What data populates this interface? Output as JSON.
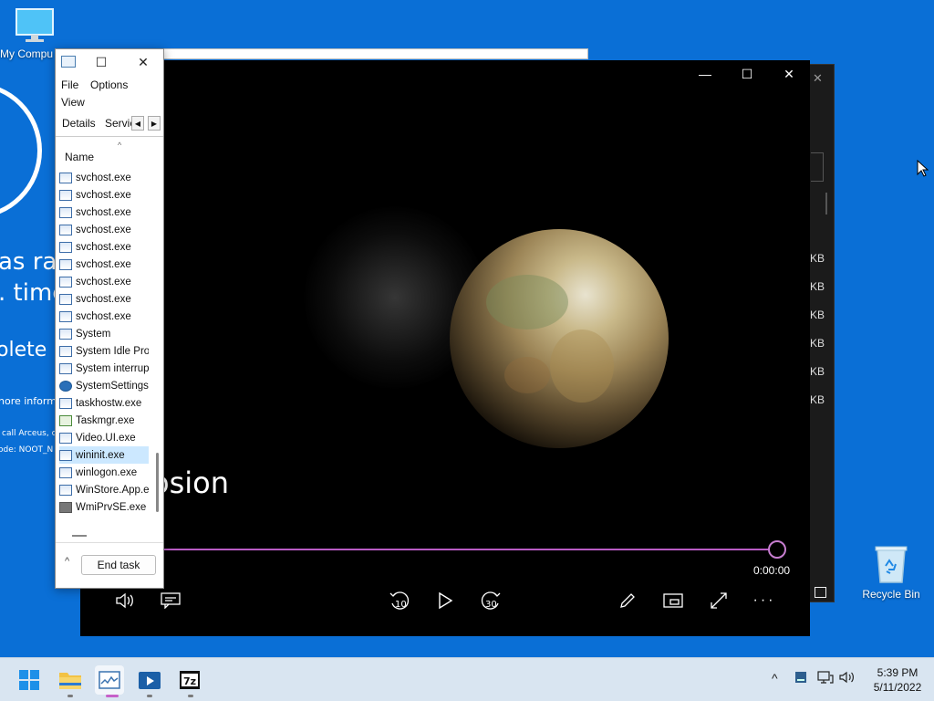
{
  "desktop": {
    "my_computer_label": "My Compu",
    "recycle_bin_label": "Recycle Bin"
  },
  "bsod": {
    "line1": "as ra",
    "line2": ". time",
    "line3": "olete",
    "line4": "nore inform",
    "line5": "call Arceus, c",
    "line6": "ode: NOOT_N"
  },
  "background_window": {
    "sizes": [
      "KB",
      "KB",
      "KB",
      "KB",
      "KB",
      "KB"
    ]
  },
  "video": {
    "caption": "osion",
    "timecode": "0:00:00",
    "progress": 1.0,
    "skip_back": "10",
    "skip_forward": "30",
    "accent": "#b85cc4"
  },
  "task_manager": {
    "menu": {
      "file": "File",
      "options": "Options",
      "view": "View"
    },
    "tabs": {
      "details": "Details",
      "services": "Servic"
    },
    "column_name": "Name",
    "processes": [
      {
        "name": "svchost.exe",
        "icon": "window-icon"
      },
      {
        "name": "svchost.exe",
        "icon": "window-icon"
      },
      {
        "name": "svchost.exe",
        "icon": "window-icon"
      },
      {
        "name": "svchost.exe",
        "icon": "window-icon"
      },
      {
        "name": "svchost.exe",
        "icon": "window-icon"
      },
      {
        "name": "svchost.exe",
        "icon": "window-icon"
      },
      {
        "name": "svchost.exe",
        "icon": "window-icon"
      },
      {
        "name": "svchost.exe",
        "icon": "window-icon"
      },
      {
        "name": "svchost.exe",
        "icon": "window-icon"
      },
      {
        "name": "System",
        "icon": "window-icon"
      },
      {
        "name": "System Idle Pro",
        "icon": "window-icon"
      },
      {
        "name": "System interrup",
        "icon": "window-icon"
      },
      {
        "name": "SystemSettings",
        "icon": "gear-icon"
      },
      {
        "name": "taskhostw.exe",
        "icon": "window-icon"
      },
      {
        "name": "Taskmgr.exe",
        "icon": "chart-icon"
      },
      {
        "name": "Video.UI.exe",
        "icon": "window-icon"
      },
      {
        "name": "wininit.exe",
        "icon": "window-icon",
        "selected": true
      },
      {
        "name": "winlogon.exe",
        "icon": "window-icon"
      },
      {
        "name": "WinStore.App.e",
        "icon": "window-icon"
      },
      {
        "name": "WmiPrvSE.exe",
        "icon": "cogs-icon"
      }
    ],
    "end_task_label": "End task"
  },
  "taskbar": {
    "time": "5:39 PM",
    "date": "5/11/2022"
  }
}
